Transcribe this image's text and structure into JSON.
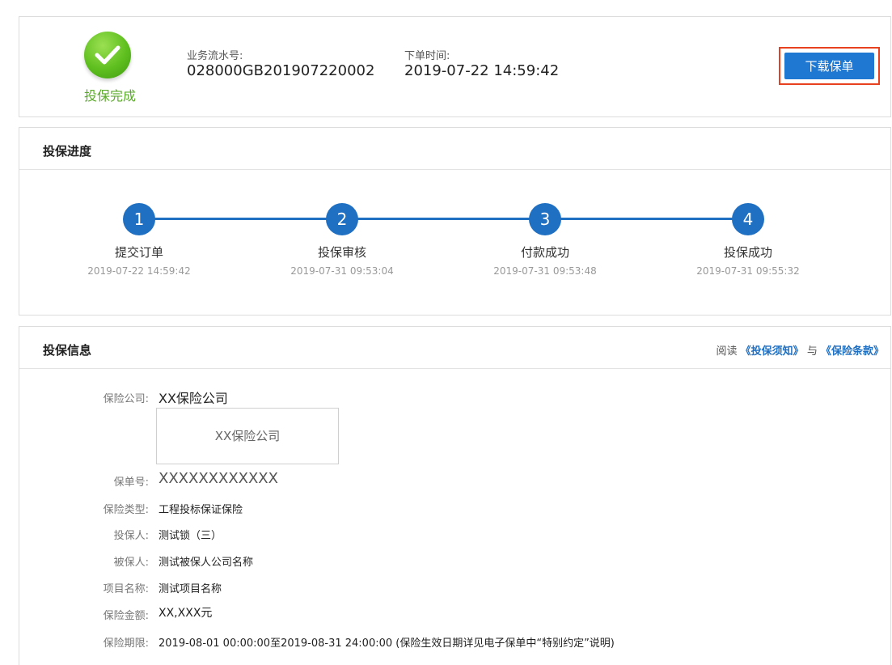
{
  "status": {
    "label": "投保完成",
    "icon": "check-icon",
    "color": "#5aaa2a"
  },
  "order": {
    "serial_label": "业务流水号:",
    "serial_value": "028000GB201907220002",
    "time_label": "下单时间:",
    "time_value": "2019-07-22 14:59:42"
  },
  "actions": {
    "download_label": "下载保单",
    "accent": "#1f78d1",
    "highlight": "#e8411f"
  },
  "progress": {
    "title": "投保进度",
    "steps": [
      {
        "num": "1",
        "label": "提交订单",
        "time": "2019-07-22 14:59:42"
      },
      {
        "num": "2",
        "label": "投保审核",
        "time": "2019-07-31 09:53:04"
      },
      {
        "num": "3",
        "label": "付款成功",
        "time": "2019-07-31 09:53:48"
      },
      {
        "num": "4",
        "label": "投保成功",
        "time": "2019-07-31 09:55:32"
      }
    ]
  },
  "info": {
    "title": "投保信息",
    "read_prefix": "阅读",
    "read_link1": "《投保须知》",
    "read_and": "与",
    "read_link2": "《保险条款》",
    "company_label": "保险公司:",
    "company_value": "XX保险公司",
    "company_logo_text": "XX保险公司",
    "policy_no_label": "保单号:",
    "policy_no_value": "XXXXXXXXXXXX",
    "type_label": "保险类型:",
    "type_value": "工程投标保证保险",
    "applicant_label": "投保人:",
    "applicant_value": "测试锁（三）",
    "insured_label": "被保人:",
    "insured_value": "测试被保人公司名称",
    "project_label": "项目名称:",
    "project_value": "测试项目名称",
    "amount_label": "保险金额:",
    "amount_value": "XX,XXX元",
    "period_label": "保险期限:",
    "period_value": "2019-08-01 00:00:00至2019-08-31 24:00:00 (保险生效日期详见电子保单中“特别约定”说明)"
  }
}
